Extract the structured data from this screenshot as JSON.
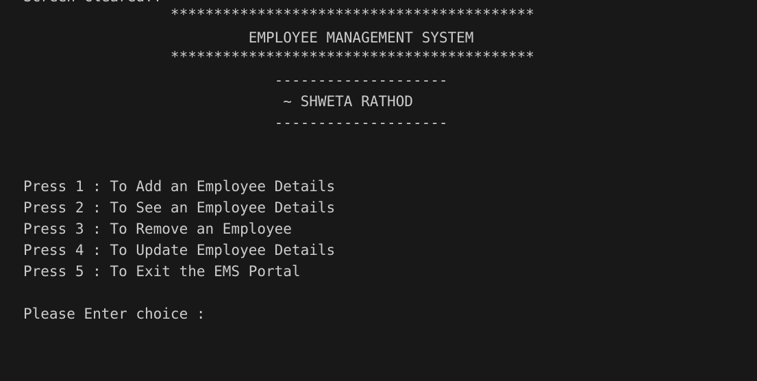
{
  "terminal": {
    "partial_top_line": "Screen Cleared!!",
    "stars_top": "                 ******************************************",
    "title": "                          EMPLOYEE MANAGEMENT SYSTEM",
    "stars_bottom": "                 ******************************************",
    "dashes_top": "                             --------------------",
    "author": "                              ~ SHWETA RATHOD",
    "dashes_bottom": "                             --------------------",
    "menu": [
      "Press 1 : To Add an Employee Details",
      "Press 2 : To See an Employee Details",
      "Press 3 : To Remove an Employee",
      "Press 4 : To Update Employee Details",
      "Press 5 : To Exit the EMS Portal"
    ],
    "prompt": "Please Enter choice : "
  },
  "colors": {
    "background": "#181818",
    "text": "#cccccc"
  }
}
